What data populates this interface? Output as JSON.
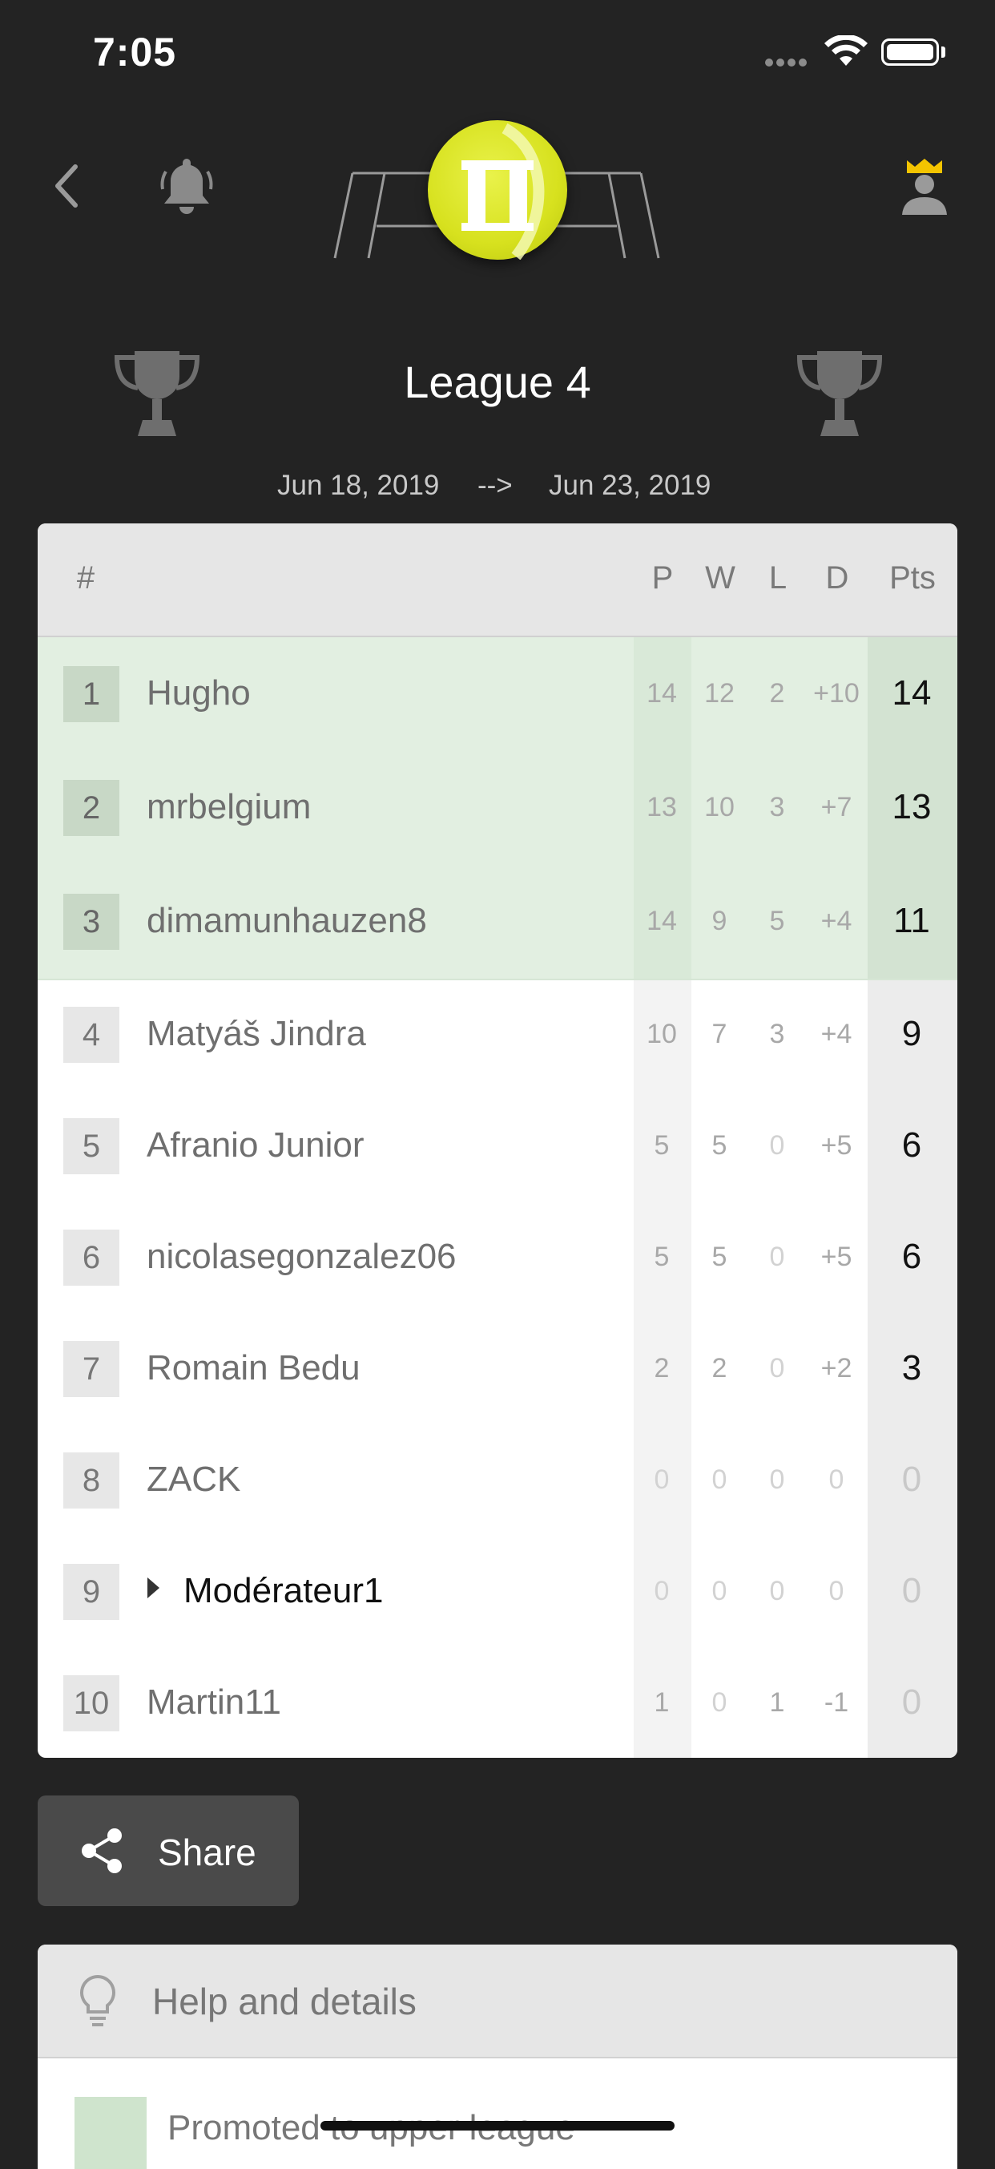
{
  "status_bar": {
    "time": "7:05"
  },
  "header": {
    "league_title": "League 4"
  },
  "period": {
    "start": "Jun 18, 2019",
    "arrow": "-->",
    "end": "Jun 23, 2019"
  },
  "table": {
    "headers": {
      "rank": "#",
      "p": "P",
      "w": "W",
      "l": "L",
      "d": "D",
      "pts": "Pts"
    },
    "rows": [
      {
        "rank": "1",
        "name": "Hugho",
        "p": "14",
        "w": "12",
        "l": "2",
        "d": "+10",
        "pts": "14",
        "promoted": true
      },
      {
        "rank": "2",
        "name": "mrbelgium",
        "p": "13",
        "w": "10",
        "l": "3",
        "d": "+7",
        "pts": "13",
        "promoted": true
      },
      {
        "rank": "3",
        "name": "dimamunhauzen8",
        "p": "14",
        "w": "9",
        "l": "5",
        "d": "+4",
        "pts": "11",
        "promoted": true
      },
      {
        "rank": "4",
        "name": "Matyáš Jindra",
        "p": "10",
        "w": "7",
        "l": "3",
        "d": "+4",
        "pts": "9"
      },
      {
        "rank": "5",
        "name": "Afranio Junior",
        "p": "5",
        "w": "5",
        "l": "0",
        "d": "+5",
        "pts": "6"
      },
      {
        "rank": "6",
        "name": "nicolasegonzalez06",
        "p": "5",
        "w": "5",
        "l": "0",
        "d": "+5",
        "pts": "6"
      },
      {
        "rank": "7",
        "name": "Romain Bedu",
        "p": "2",
        "w": "2",
        "l": "0",
        "d": "+2",
        "pts": "3"
      },
      {
        "rank": "8",
        "name": "ZACK",
        "p": "0",
        "w": "0",
        "l": "0",
        "d": "0",
        "pts": "0"
      },
      {
        "rank": "9",
        "name": "Modérateur1",
        "p": "0",
        "w": "0",
        "l": "0",
        "d": "0",
        "pts": "0"
      },
      {
        "rank": "10",
        "name": "Martin11",
        "p": "1",
        "w": "0",
        "l": "1",
        "d": "-1",
        "pts": "0"
      }
    ]
  },
  "share": {
    "label": "Share"
  },
  "help": {
    "title": "Help and details",
    "legend_promoted": "Promoted to upper league"
  },
  "colors": {
    "background": "#232323",
    "promoted_row": "#e2efe1",
    "logo": "#d7e11e",
    "premium_crown": "#f4c400"
  }
}
